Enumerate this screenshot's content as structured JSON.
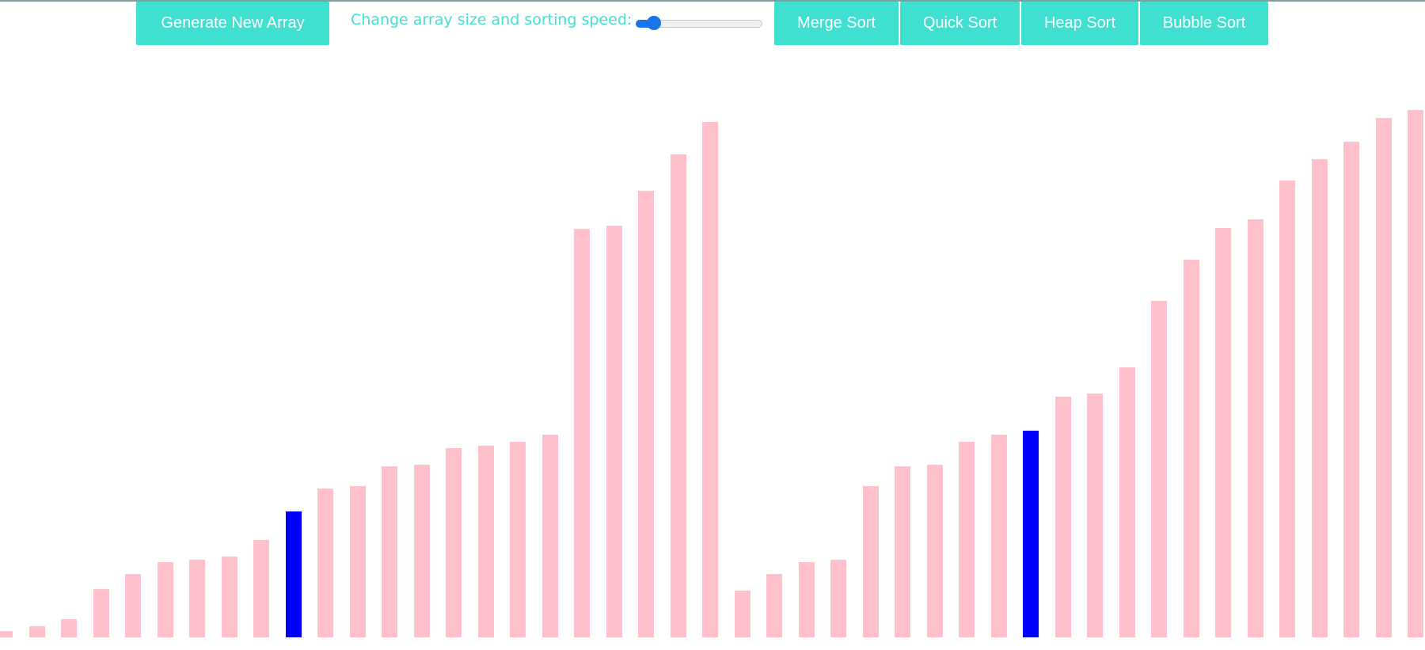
{
  "toolbar": {
    "generate_label": "Generate New Array",
    "speed_label": "Change array size and sorting speed:",
    "slider_value_fraction": 0.1,
    "merge_label": "Merge Sort",
    "quick_label": "Quick Sort",
    "heap_label": "Heap Sort",
    "bubble_label": "Bubble Sort"
  },
  "colors": {
    "accent": "#40e0d0",
    "bar_default": "#ffc0cb",
    "bar_active": "#0000ff",
    "slider": "#1a73e8"
  },
  "array_values": [
    8,
    14,
    23,
    61,
    80,
    95,
    98,
    102,
    123,
    159,
    188,
    191,
    216,
    218,
    239,
    242,
    247,
    256,
    516,
    520,
    564,
    610,
    651,
    59,
    80,
    95,
    98,
    191,
    216,
    218,
    247,
    256,
    261,
    304,
    308,
    341,
    425,
    477,
    517,
    528,
    577,
    604,
    626,
    656,
    666
  ],
  "active_indices": [
    9,
    32
  ]
}
